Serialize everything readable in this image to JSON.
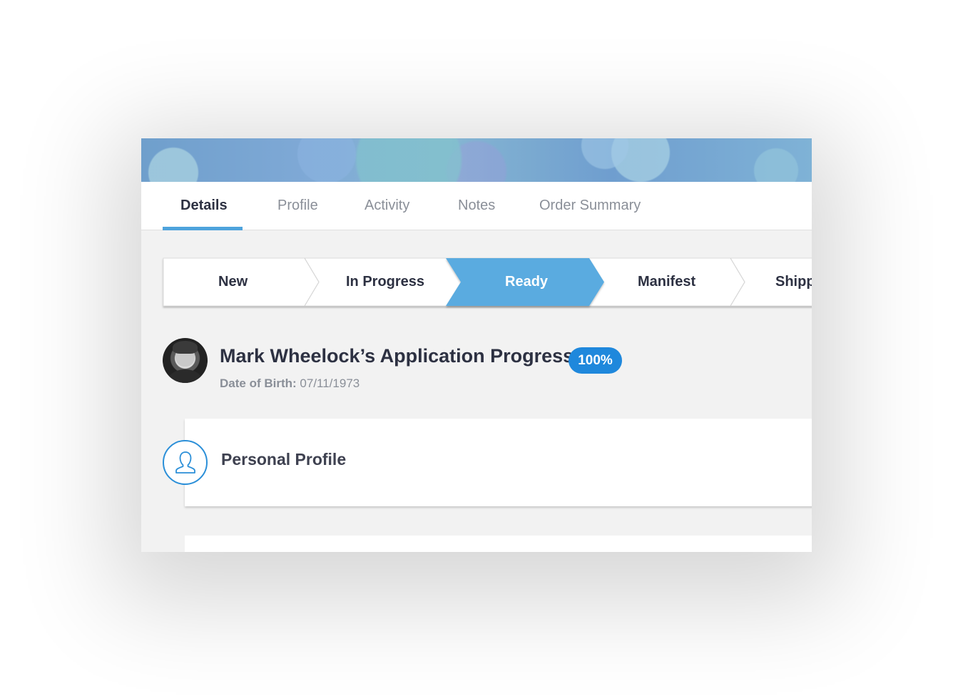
{
  "tabs": [
    {
      "label": "Details",
      "active": true
    },
    {
      "label": "Profile",
      "active": false
    },
    {
      "label": "Activity",
      "active": false
    },
    {
      "label": "Notes",
      "active": false
    },
    {
      "label": "Order Summary",
      "active": false
    }
  ],
  "stages": [
    {
      "label": "New",
      "current": false
    },
    {
      "label": "In Progress",
      "current": false
    },
    {
      "label": "Ready",
      "current": true
    },
    {
      "label": "Manifest",
      "current": false
    },
    {
      "label": "Shipp",
      "current": false
    }
  ],
  "applicant": {
    "title": "Mark Wheelock’s Application Progress",
    "progress_badge": "100%",
    "dob_label": "Date of Birth:",
    "dob_value": "07/11/1973"
  },
  "sections": [
    {
      "title": "Personal Profile",
      "icon": "user-icon"
    }
  ],
  "colors": {
    "accent": "#4ea3dc",
    "current_stage": "#5aabe0",
    "badge": "#1f88dc",
    "text_dark": "#2d3142",
    "text_muted": "#8a8f98"
  }
}
